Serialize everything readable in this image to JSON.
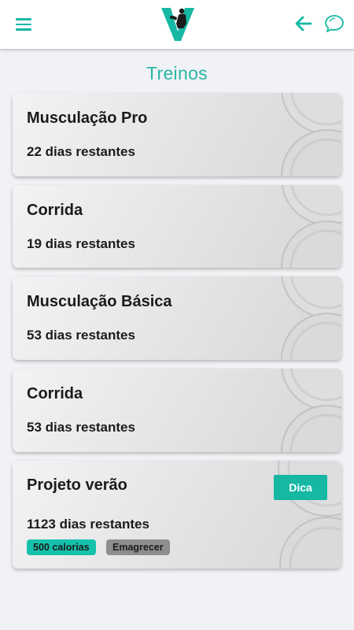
{
  "header": {
    "menu_icon": "hamburger-menu-icon",
    "logo_icon": "v-fitness-logo",
    "back_icon": "arrow-left-icon",
    "chat_icon": "chat-bubbles-icon",
    "accent_color": "#16b8a4"
  },
  "page_title": "Treinos",
  "workouts": [
    {
      "title": "Musculação Pro",
      "days": "22 dias restantes"
    },
    {
      "title": "Corrida",
      "days": "19 dias restantes"
    },
    {
      "title": "Musculação Básica",
      "days": "53 dias restantes"
    },
    {
      "title": "Corrida",
      "days": "53 dias restantes"
    },
    {
      "title": "Projeto verão",
      "days": "1123 dias restantes",
      "tip_button": "Dica",
      "tags": [
        "500 calorias",
        "Emagrecer"
      ]
    }
  ]
}
